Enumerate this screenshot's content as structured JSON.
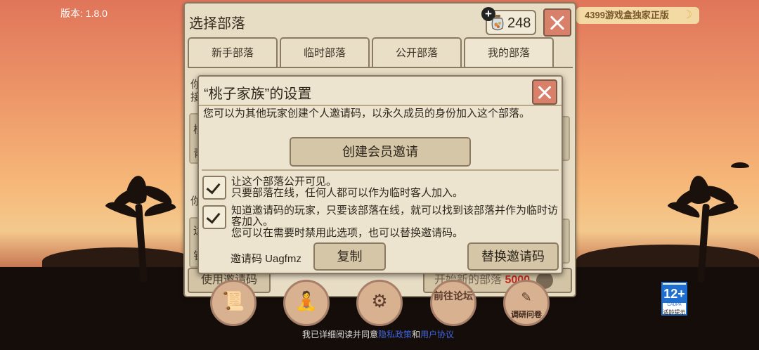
{
  "version": "版本: 1.8.0",
  "banner": {
    "text": "4399游戏盒独家正版",
    "icon": "moon-icon"
  },
  "panel": {
    "title": "选择部落",
    "gems": 248,
    "tabs": [
      {
        "label": "新手部落"
      },
      {
        "label": "临时部落"
      },
      {
        "label": "公开部落"
      },
      {
        "label": "我的部落"
      }
    ],
    "under": {
      "use_code": "使用邀请码",
      "start_new": "开始新的部落",
      "start_cost": "5000",
      "text_a": "你",
      "text_b": "接",
      "text_c": "你",
      "text_d": "棂",
      "text_e": "青",
      "text_f": "运",
      "text_g": "钅"
    }
  },
  "dialog": {
    "title": "“桃子家族”的设置",
    "description": "您可以为其他玩家创建个人邀请码，以永久成员的身份加入这个部落。",
    "create_button": "创建会员邀请",
    "options": [
      {
        "checked": true,
        "line1": "让这个部落公开可见。",
        "line2": "只要部落在线，任何人都可以作为临时客人加入。"
      },
      {
        "checked": true,
        "line1": "知道邀请码的玩家，只要该部落在线，就可以找到该部落并作为临时访客加入。",
        "line2": "您可以在需要时禁用此选项，也可以替换邀请码。"
      }
    ],
    "invite_code_label": "邀请码 Uagfmz",
    "copy_button": "复制",
    "replace_button": "替换邀请码"
  },
  "bottom_icons": [
    {
      "name": "scroll-icon",
      "glyph": "📜",
      "label": ""
    },
    {
      "name": "meditation-icon",
      "glyph": "🧘",
      "label": ""
    },
    {
      "name": "settings-icon",
      "glyph": "⚙",
      "label": ""
    },
    {
      "name": "forum-icon",
      "glyph": "",
      "label": "前往论坛"
    },
    {
      "name": "survey-icon",
      "glyph": "",
      "label": "调研问卷"
    }
  ],
  "age_rating": {
    "number": "12+",
    "org": "CADPA",
    "tip": "适龄提示"
  },
  "consent": {
    "prefix": "我已详细阅读并同意",
    "privacy": "隐私政策",
    "and": "和",
    "agreement": "用户协议"
  }
}
